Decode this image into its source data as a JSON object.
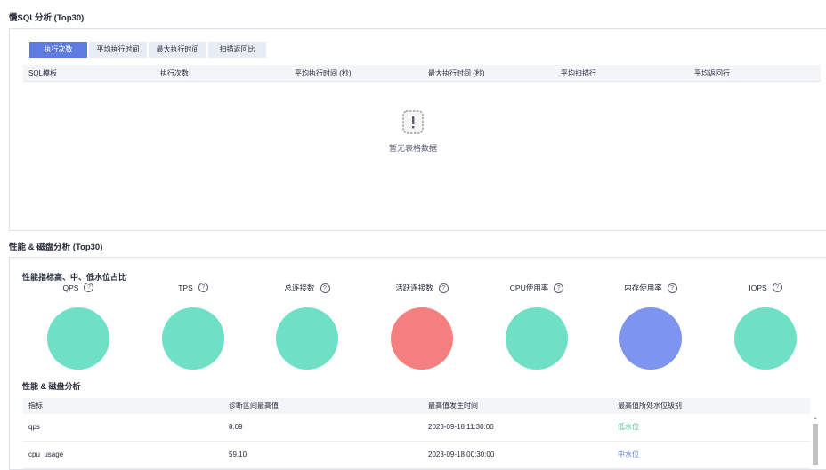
{
  "slow_sql": {
    "title": "慢SQL分析 (Top30)",
    "tabs": [
      {
        "label": "执行次数",
        "active": true
      },
      {
        "label": "平均执行时间",
        "active": false
      },
      {
        "label": "最大执行时间",
        "active": false
      },
      {
        "label": "扫描返回比",
        "active": false
      }
    ],
    "columns": [
      "SQL模板",
      "执行次数",
      "平均执行时间 (秒)",
      "最大执行时间 (秒)",
      "平均扫描行",
      "平均返回行"
    ],
    "empty_text": "暂无表格数据"
  },
  "perf": {
    "title": "性能 & 磁盘分析 (Top30)",
    "ratio_title": "性能指标高、中、低水位占比",
    "metrics": [
      {
        "label": "QPS",
        "color": "#6fe0c6"
      },
      {
        "label": "TPS",
        "color": "#6fe0c6"
      },
      {
        "label": "总连接数",
        "color": "#6fe0c6"
      },
      {
        "label": "活跃连接数",
        "color": "#f47f7f"
      },
      {
        "label": "CPU使用率",
        "color": "#6fe0c6"
      },
      {
        "label": "内存使用率",
        "color": "#7d95ef"
      },
      {
        "label": "IOPS",
        "color": "#6fe0c6"
      }
    ],
    "table_title": "性能 & 磁盘分析",
    "columns": [
      "指标",
      "诊断区间最高值",
      "最高值发生时间",
      "最高值所处水位级别"
    ],
    "rows": [
      {
        "metric": "qps",
        "max": "8.09",
        "time": "2023-09-18 11:30:00",
        "level": "低水位",
        "level_color": "#3ac295"
      },
      {
        "metric": "cpu_usage",
        "max": "59.10",
        "time": "2023-09-18 00:30:00",
        "level": "中水位",
        "level_color": "#5e7ce0"
      }
    ]
  }
}
